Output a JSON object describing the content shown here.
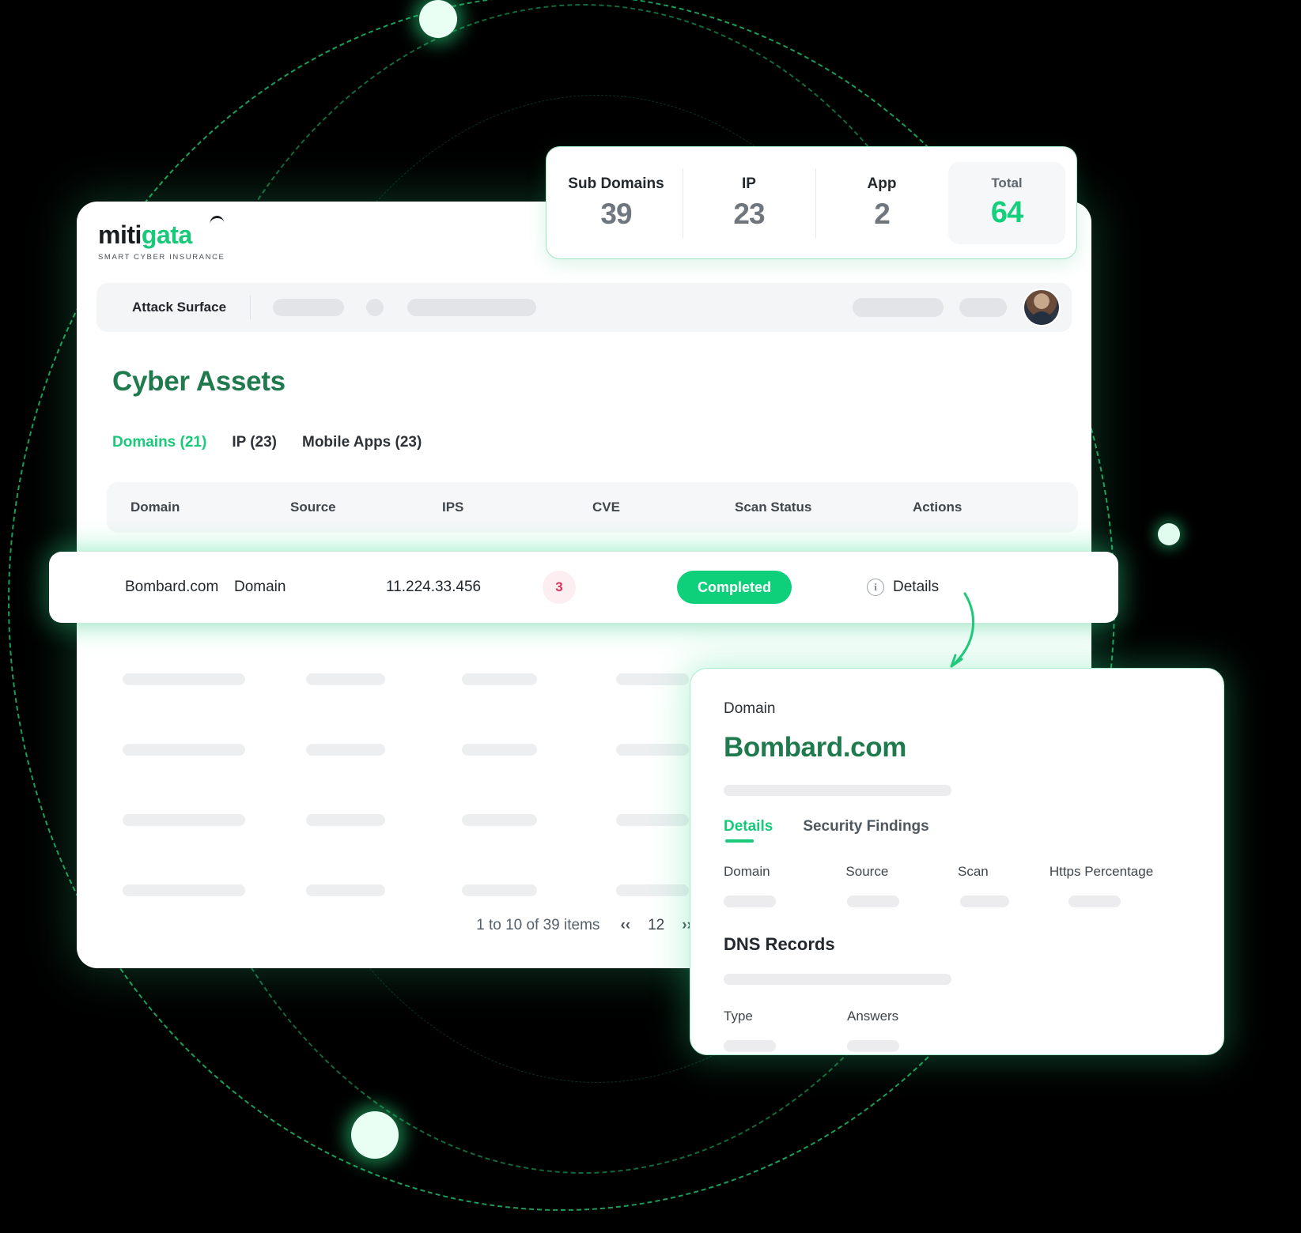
{
  "brand": {
    "name_dark": "miti",
    "name_green": "gata",
    "tagline": "SMART CYBER INSURANCE",
    "accent_color": "#18c97a"
  },
  "topbar": {
    "title": "Attack Surface"
  },
  "page": {
    "title": "Cyber Assets",
    "tabs": [
      {
        "label": "Domains (21)",
        "active": true
      },
      {
        "label": "IP (23)",
        "active": false
      },
      {
        "label": "Mobile Apps (23)",
        "active": false
      }
    ]
  },
  "stats": {
    "items": [
      {
        "label": "Sub Domains",
        "value": "39"
      },
      {
        "label": "IP",
        "value": "23"
      },
      {
        "label": "App",
        "value": "2"
      }
    ],
    "total": {
      "label": "Total",
      "value": "64",
      "color": "#14cf7c"
    }
  },
  "table": {
    "headers": {
      "domain": "Domain",
      "source": "Source",
      "ips": "IPS",
      "cve": "CVE",
      "scan_status": "Scan Status",
      "actions": "Actions"
    },
    "highlighted_row": {
      "domain": "Bombard.com",
      "source": "Domain",
      "ips": "11.224.33.456",
      "cve": "3",
      "scan_status": "Completed",
      "action_label": "Details",
      "action_icon": "info-icon",
      "status_color": "#0ed07a",
      "cve_color": "#d6335c"
    }
  },
  "pagination": {
    "info": "1 to 10 of 39 items",
    "prev": "‹‹",
    "page": "12",
    "next": "››"
  },
  "detail_panel": {
    "label": "Domain",
    "domain": "Bombard.com",
    "tabs": [
      {
        "label": "Details",
        "active": true
      },
      {
        "label": "Security Findings",
        "active": false
      }
    ],
    "columns": [
      "Domain",
      "Source",
      "Scan",
      "Https Percentage"
    ],
    "section_title": "DNS Records",
    "dns_columns": [
      "Type",
      "Answers"
    ]
  }
}
